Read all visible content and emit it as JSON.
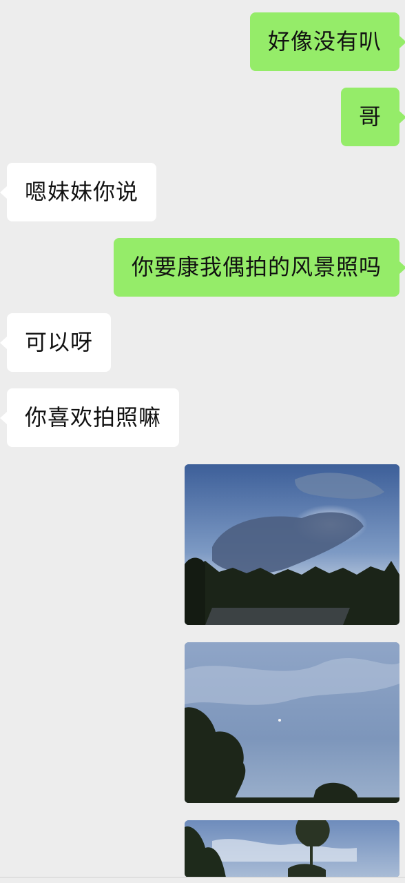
{
  "messages": [
    {
      "side": "out",
      "text": "好像没有叭"
    },
    {
      "side": "out",
      "text": "哥"
    },
    {
      "side": "in",
      "text": "嗯妹妹你说"
    },
    {
      "side": "out",
      "text": "你要康我偶拍的风景照吗"
    },
    {
      "side": "in",
      "text": "可以呀"
    },
    {
      "side": "in",
      "text": "你喜欢拍照嘛"
    }
  ],
  "photos": [
    {
      "subject": "cloudy-sky-over-trees"
    },
    {
      "subject": "blue-sky-with-tree-silhouettes"
    },
    {
      "subject": "tall-tree-against-sky"
    }
  ],
  "colors": {
    "background": "#ededed",
    "outgoing_bubble": "#95ec69",
    "incoming_bubble": "#ffffff",
    "text": "#111111"
  }
}
